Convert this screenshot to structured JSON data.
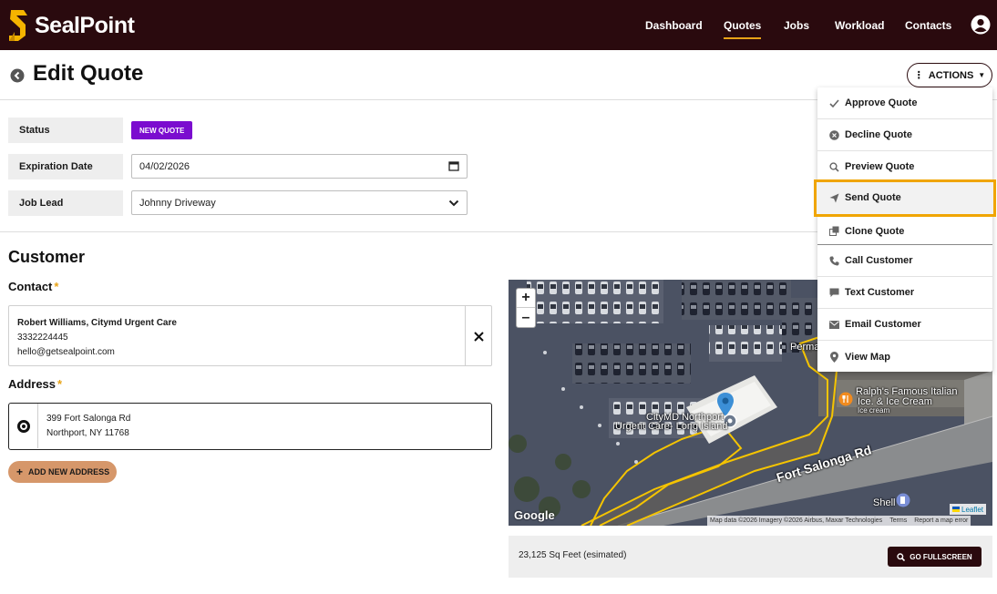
{
  "app": {
    "brand": "SealPoint"
  },
  "nav": {
    "items": [
      {
        "label": "Dashboard"
      },
      {
        "label": "Quotes"
      },
      {
        "label": "Jobs"
      },
      {
        "label": "Workload"
      },
      {
        "label": "Contacts"
      }
    ],
    "active": "Quotes"
  },
  "page": {
    "title": "Edit Quote",
    "actions_label": "ACTIONS"
  },
  "form": {
    "status_label": "Status",
    "status_value": "NEW QUOTE",
    "status_color": "#7b0ccf",
    "expiration_label": "Expiration Date",
    "expiration_value": "04/02/2026",
    "job_lead_label": "Job Lead",
    "job_lead_value": "Johnny Driveway"
  },
  "customer": {
    "section_title": "Customer",
    "contact_title": "Contact",
    "contact_name": "Robert Williams, Citymd Urgent Care",
    "contact_phone": "3332224445",
    "contact_email": "hello@getsealpoint.com",
    "address_title": "Address",
    "address_line1": "399 Fort Salonga Rd",
    "address_line2": "Northport, NY 11768",
    "add_address_label": "ADD NEW ADDRESS",
    "required_mark": "*"
  },
  "map": {
    "zoom_in": "+",
    "zoom_out": "–",
    "labels": {
      "citymd": "CityMD Northport",
      "citymd2": "Urgent Care- Long Island",
      "ralphs": "Ralph's Famous Italian",
      "ralphs2": "Ice. & Ice Cream",
      "ralphs3": "Ice cream",
      "road": "Fort Salonga Rd",
      "perma": "Perma",
      "shell": "Shell"
    },
    "google": "Google",
    "attribution": "Map data ©2026 Imagery ©2026 Airbus, Maxar Technologies",
    "terms": "Terms",
    "report": "Report a map error",
    "leaflet": "Leaflet",
    "area_text": "23,125 Sq Feet (esimated)",
    "fullscreen_label": "GO FULLSCREEN",
    "outline_color": "#f5c400"
  },
  "actions_menu": {
    "items": [
      {
        "label": "Approve Quote",
        "icon": "check-icon"
      },
      {
        "label": "Decline Quote",
        "icon": "x-circle-icon"
      },
      {
        "label": "Preview Quote",
        "icon": "search-icon"
      },
      {
        "label": "Send Quote",
        "icon": "paper-plane-icon"
      },
      {
        "label": "Clone Quote",
        "icon": "copy-icon"
      },
      {
        "label": "Call Customer",
        "icon": "phone-icon"
      },
      {
        "label": "Text Customer",
        "icon": "chat-icon"
      },
      {
        "label": "Email Customer",
        "icon": "envelope-icon"
      },
      {
        "label": "View Map",
        "icon": "map-pin-icon"
      }
    ],
    "highlighted": "Send Quote",
    "highlight_color": "#f0a500"
  },
  "colors": {
    "header_bg": "#2a0a0e",
    "accent": "#e8a317",
    "add_button": "#d6976a"
  }
}
